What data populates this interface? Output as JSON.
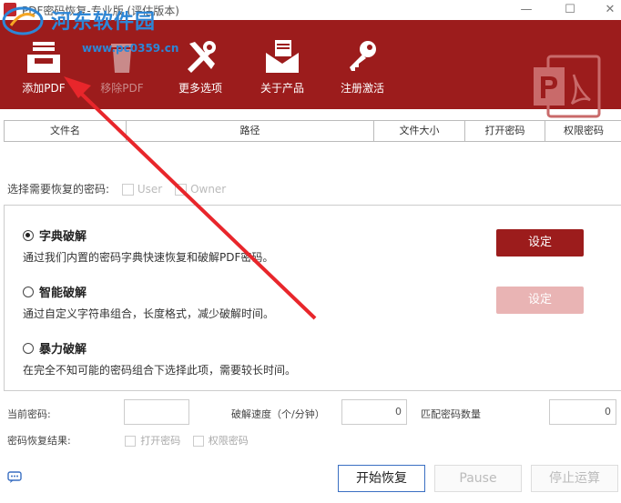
{
  "window": {
    "title": "PDF密码恢复-专业版 (评估版本)",
    "minimize": "—",
    "maximize": "☐",
    "close": "✕"
  },
  "watermark": {
    "name": "河东软件园",
    "url": "www.pc0359.cn"
  },
  "toolbar": {
    "items": [
      {
        "label": "添加PDF",
        "icon": "inbox-tray-icon",
        "enabled": true
      },
      {
        "label": "移除PDF",
        "icon": "trash-icon",
        "enabled": false
      },
      {
        "label": "更多选项",
        "icon": "tools-icon",
        "enabled": true
      },
      {
        "label": "关于产品",
        "icon": "envelope-icon",
        "enabled": true
      },
      {
        "label": "注册激活",
        "icon": "key-icon",
        "enabled": true
      }
    ]
  },
  "table": {
    "columns": [
      "文件名",
      "路径",
      "文件大小",
      "打开密码",
      "权限密码"
    ]
  },
  "password_select": {
    "label": "选择需要恢复的密码:",
    "user": "User",
    "owner": "Owner"
  },
  "modes": [
    {
      "title": "字典破解",
      "desc": "通过我们内置的密码字典快速恢复和破解PDF密码。",
      "selected": true,
      "button": "设定",
      "button_enabled": true
    },
    {
      "title": "智能破解",
      "desc": "通过自定义字符串组合，长度格式，减少破解时间。",
      "selected": false,
      "button": "设定",
      "button_enabled": false
    },
    {
      "title": "暴力破解",
      "desc": "在完全不知可能的密码组合下选择此项，需要较长时间。",
      "selected": false
    }
  ],
  "status": {
    "current_label": "当前密码:",
    "current_value": "",
    "speed_label": "破解速度（个/分钟）",
    "speed_value": "0",
    "match_label": "匹配密码数量",
    "match_value": "0",
    "result_label": "密码恢复结果:",
    "result_open": "打开密码",
    "result_perm": "权限密码"
  },
  "buttons": {
    "start": "开始恢复",
    "pause": "Pause",
    "stop": "停止运算"
  },
  "colors": {
    "brand": "#9c1c1c",
    "button": "#9c1c1c",
    "button_disabled": "#e9b4b4",
    "arrow": "#e8262b"
  }
}
